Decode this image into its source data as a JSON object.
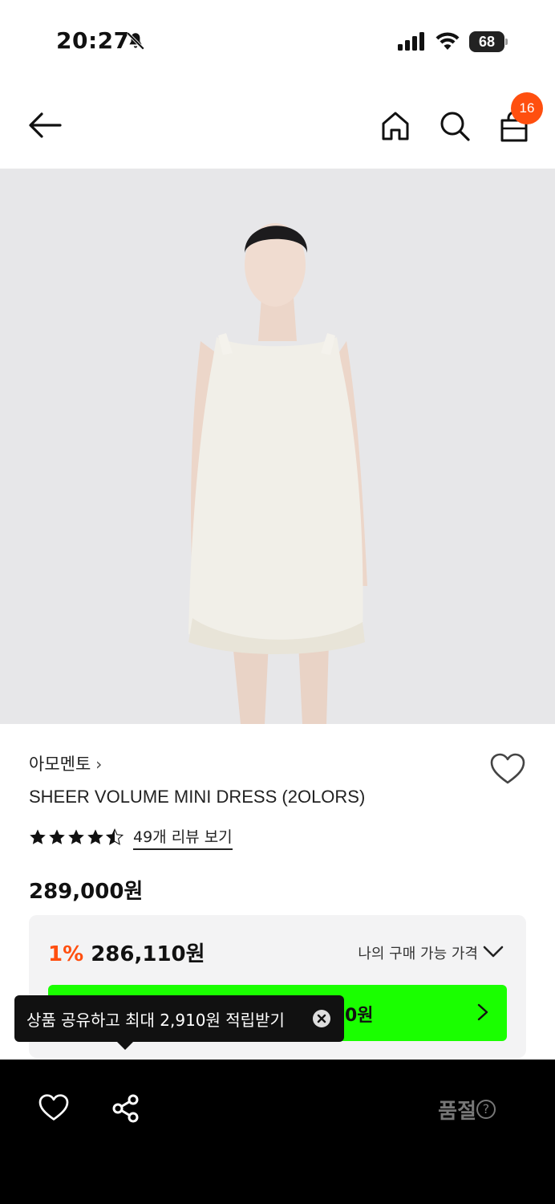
{
  "status": {
    "time": "20:27",
    "battery": "68"
  },
  "nav": {
    "cart_count": "16"
  },
  "product": {
    "brand": "아모멘토",
    "brand_chevron": "›",
    "title": "SHEER VOLUME MINI DRESS (2OLORS)",
    "rating": 4.5,
    "review_link": "49개 리뷰 보기",
    "price": "289,000원"
  },
  "price_box": {
    "discount_pct": "1%",
    "discount_price": "286,110원",
    "my_price_label": "나의 구매 가능 가격",
    "button_text_visible": "0원"
  },
  "tooltip": {
    "text": "상품 공유하고 최대 2,910원 적립받기"
  },
  "bottom": {
    "status": "품절",
    "help": "?"
  },
  "colors": {
    "accent": "#ff4f0f",
    "green": "#1aff00"
  }
}
